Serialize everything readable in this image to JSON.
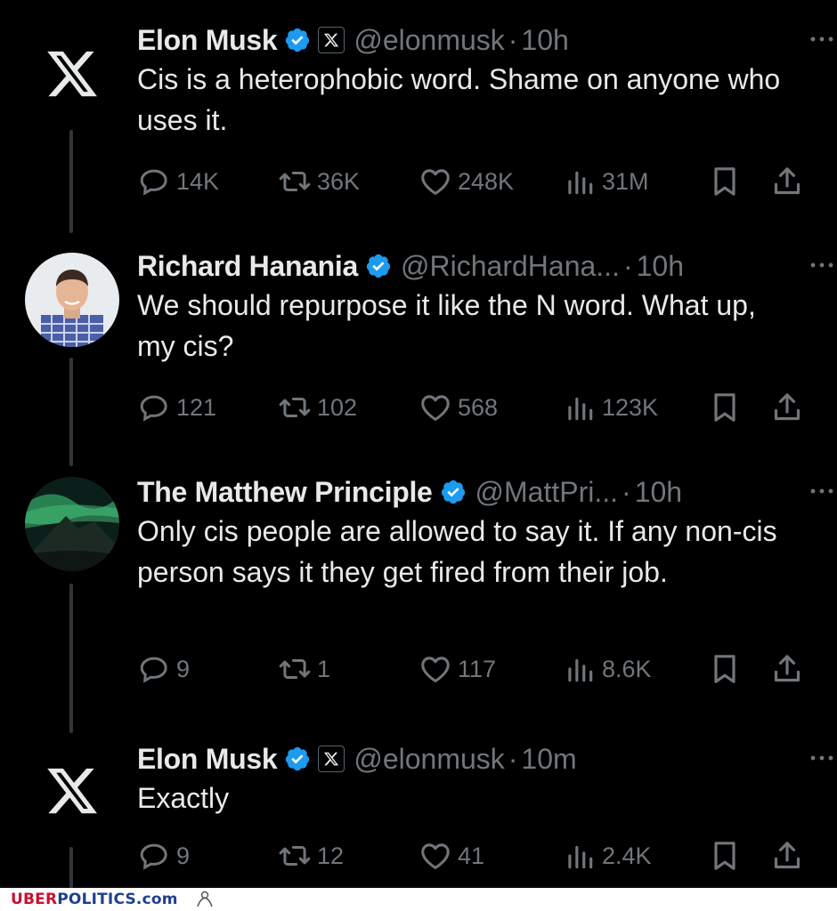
{
  "colors": {
    "background": "#000000",
    "text": "#e7e9ea",
    "muted": "#71767b",
    "verified": "#1d9bf0",
    "thread_line": "#333639"
  },
  "tweets": [
    {
      "name": "Elon Musk",
      "handle": "@elonmusk",
      "dot": "·",
      "time": "10h",
      "avatar": "x-logo",
      "badges": [
        "verified-icon",
        "x-affiliate-badge"
      ],
      "text": "Cis is a heterophobic word. Shame on anyone who uses it.",
      "replies": "14K",
      "reposts": "36K",
      "likes": "248K",
      "views": "31M"
    },
    {
      "name": "Richard Hanania",
      "handle": "@RichardHana...",
      "dot": "·",
      "time": "10h",
      "avatar": "profile-photo",
      "badges": [
        "verified-icon"
      ],
      "text": "We should repurpose it like the N word. What up, my cis?",
      "replies": "121",
      "reposts": "102",
      "likes": "568",
      "views": "123K"
    },
    {
      "name": "The Matthew Principle",
      "handle": "@MattPri...",
      "dot": "·",
      "time": "10h",
      "avatar": "aurora-landscape",
      "badges": [
        "verified-icon"
      ],
      "text": "Only cis people are allowed to say it. If any non-cis person says it they get fired from their job.",
      "replies": "9",
      "reposts": "1",
      "likes": "117",
      "views": "8.6K"
    },
    {
      "name": "Elon Musk",
      "handle": "@elonmusk",
      "dot": "·",
      "time": "10m",
      "avatar": "x-logo",
      "badges": [
        "verified-icon",
        "x-affiliate-badge"
      ],
      "text": "Exactly",
      "replies": "9",
      "reposts": "12",
      "likes": "41",
      "views": "2.4K"
    }
  ],
  "footer": {
    "brand_part1": "UBER",
    "brand_part2": "POLITICS",
    "brand_part3": ".com"
  }
}
